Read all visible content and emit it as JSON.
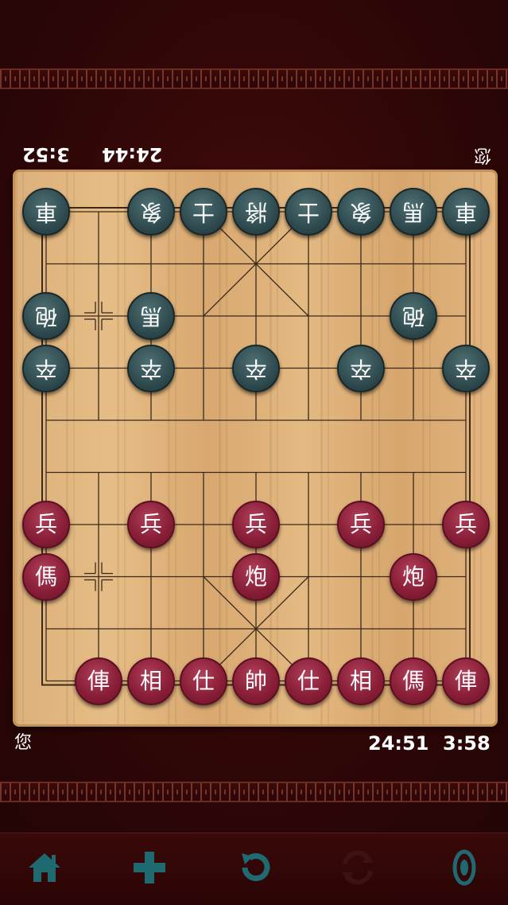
{
  "players": {
    "top": {
      "name": "您",
      "total_time": "24:44",
      "move_time": "3:52"
    },
    "bottom": {
      "name": "您",
      "total_time": "24:51",
      "move_time": "3:58"
    }
  },
  "colors": {
    "red_piece": "#8a1f38",
    "black_piece": "#2f4b4f",
    "board_wood": "#e0b47c",
    "toolbar_icon": "#1f6a70",
    "background": "#2f0707"
  },
  "board": {
    "files": 9,
    "ranks": 10,
    "pieces": [
      {
        "side": "black",
        "glyph": "車",
        "file": 0,
        "rank": 0
      },
      {
        "side": "black",
        "glyph": "象",
        "file": 2,
        "rank": 0
      },
      {
        "side": "black",
        "glyph": "士",
        "file": 3,
        "rank": 0
      },
      {
        "side": "black",
        "glyph": "將",
        "file": 4,
        "rank": 0
      },
      {
        "side": "black",
        "glyph": "士",
        "file": 5,
        "rank": 0
      },
      {
        "side": "black",
        "glyph": "象",
        "file": 6,
        "rank": 0
      },
      {
        "side": "black",
        "glyph": "馬",
        "file": 7,
        "rank": 0
      },
      {
        "side": "black",
        "glyph": "車",
        "file": 8,
        "rank": 0
      },
      {
        "side": "black",
        "glyph": "砲",
        "file": 0,
        "rank": 2
      },
      {
        "side": "black",
        "glyph": "馬",
        "file": 2,
        "rank": 2
      },
      {
        "side": "black",
        "glyph": "砲",
        "file": 7,
        "rank": 2
      },
      {
        "side": "black",
        "glyph": "卒",
        "file": 0,
        "rank": 3
      },
      {
        "side": "black",
        "glyph": "卒",
        "file": 2,
        "rank": 3
      },
      {
        "side": "black",
        "glyph": "卒",
        "file": 4,
        "rank": 3
      },
      {
        "side": "black",
        "glyph": "卒",
        "file": 6,
        "rank": 3
      },
      {
        "side": "black",
        "glyph": "卒",
        "file": 8,
        "rank": 3
      },
      {
        "side": "red",
        "glyph": "兵",
        "file": 0,
        "rank": 6
      },
      {
        "side": "red",
        "glyph": "兵",
        "file": 2,
        "rank": 6
      },
      {
        "side": "red",
        "glyph": "兵",
        "file": 4,
        "rank": 6
      },
      {
        "side": "red",
        "glyph": "兵",
        "file": 6,
        "rank": 6
      },
      {
        "side": "red",
        "glyph": "兵",
        "file": 8,
        "rank": 6
      },
      {
        "side": "red",
        "glyph": "傌",
        "file": 0,
        "rank": 7
      },
      {
        "side": "red",
        "glyph": "炮",
        "file": 4,
        "rank": 7
      },
      {
        "side": "red",
        "glyph": "炮",
        "file": 7,
        "rank": 7
      },
      {
        "side": "red",
        "glyph": "俥",
        "file": 1,
        "rank": 9
      },
      {
        "side": "red",
        "glyph": "相",
        "file": 2,
        "rank": 9
      },
      {
        "side": "red",
        "glyph": "仕",
        "file": 3,
        "rank": 9
      },
      {
        "side": "red",
        "glyph": "帥",
        "file": 4,
        "rank": 9
      },
      {
        "side": "red",
        "glyph": "仕",
        "file": 5,
        "rank": 9
      },
      {
        "side": "red",
        "glyph": "相",
        "file": 6,
        "rank": 9
      },
      {
        "side": "red",
        "glyph": "傌",
        "file": 7,
        "rank": 9
      },
      {
        "side": "red",
        "glyph": "俥",
        "file": 8,
        "rank": 9
      }
    ],
    "last_move_markers": [
      {
        "file": 1,
        "rank": 2
      },
      {
        "file": 1,
        "rank": 7
      }
    ]
  },
  "toolbar": {
    "items": [
      {
        "icon": "home-icon",
        "enabled": true
      },
      {
        "icon": "plus-icon",
        "enabled": true
      },
      {
        "icon": "undo-icon",
        "enabled": true
      },
      {
        "icon": "swap-icon",
        "enabled": false
      },
      {
        "icon": "sound-icon",
        "enabled": true
      }
    ]
  }
}
